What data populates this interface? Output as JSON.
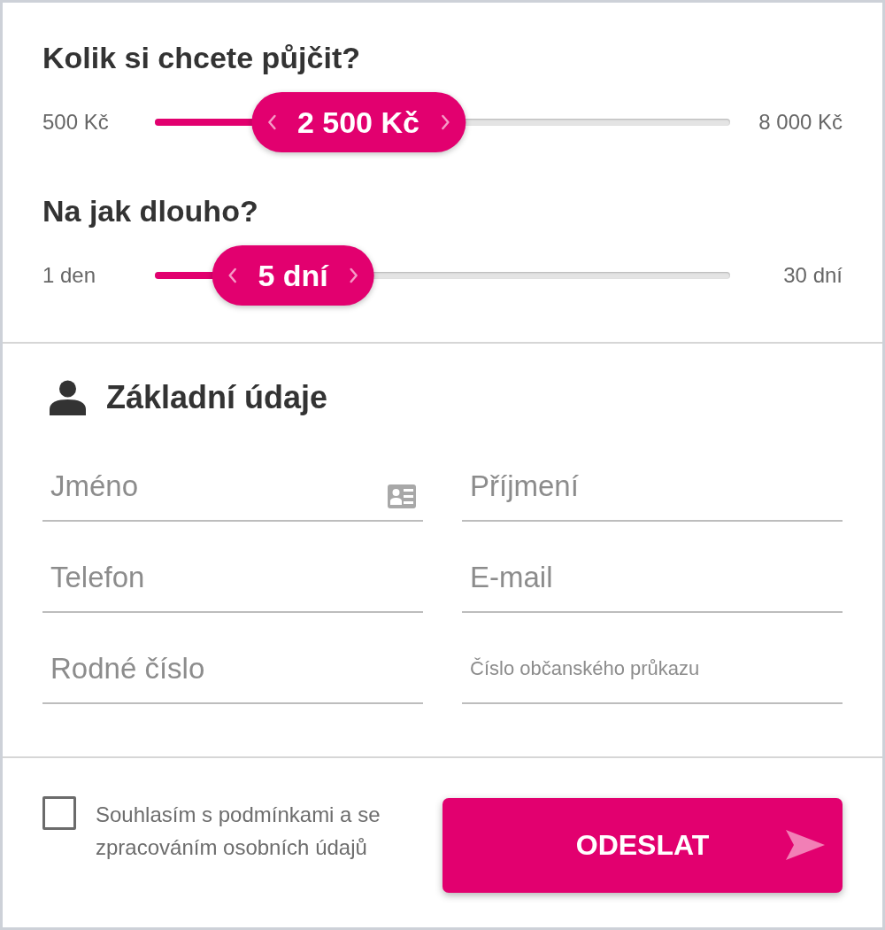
{
  "sliders": [
    {
      "title": "Kolik si chcete půjčit?",
      "min_label": "500 Kč",
      "value": "2 500 Kč",
      "max_label": "8 000 Kč",
      "level": 0.267
    },
    {
      "title": "Na jak dlouho?",
      "min_label": "1 den",
      "value": "5 dní",
      "max_label": "30 dní",
      "level": 0.138
    }
  ],
  "section": {
    "title": "Základní údaje"
  },
  "fields": [
    {
      "kind": "contact",
      "placeholder": "Jméno"
    },
    {
      "kind": "text",
      "placeholder": "Příjmení"
    },
    {
      "kind": "text",
      "placeholder": "Telefon"
    },
    {
      "kind": "text",
      "placeholder": "E-mail"
    },
    {
      "kind": "text",
      "placeholder": "Rodné číslo"
    },
    {
      "kind": "compact",
      "placeholder": "Číslo občanského průkazu"
    }
  ],
  "consent": {
    "checked": false,
    "label": "Souhlasím s podmínkami a se zpracováním osobních údajů"
  },
  "submit": {
    "label": "ODESLAT"
  }
}
